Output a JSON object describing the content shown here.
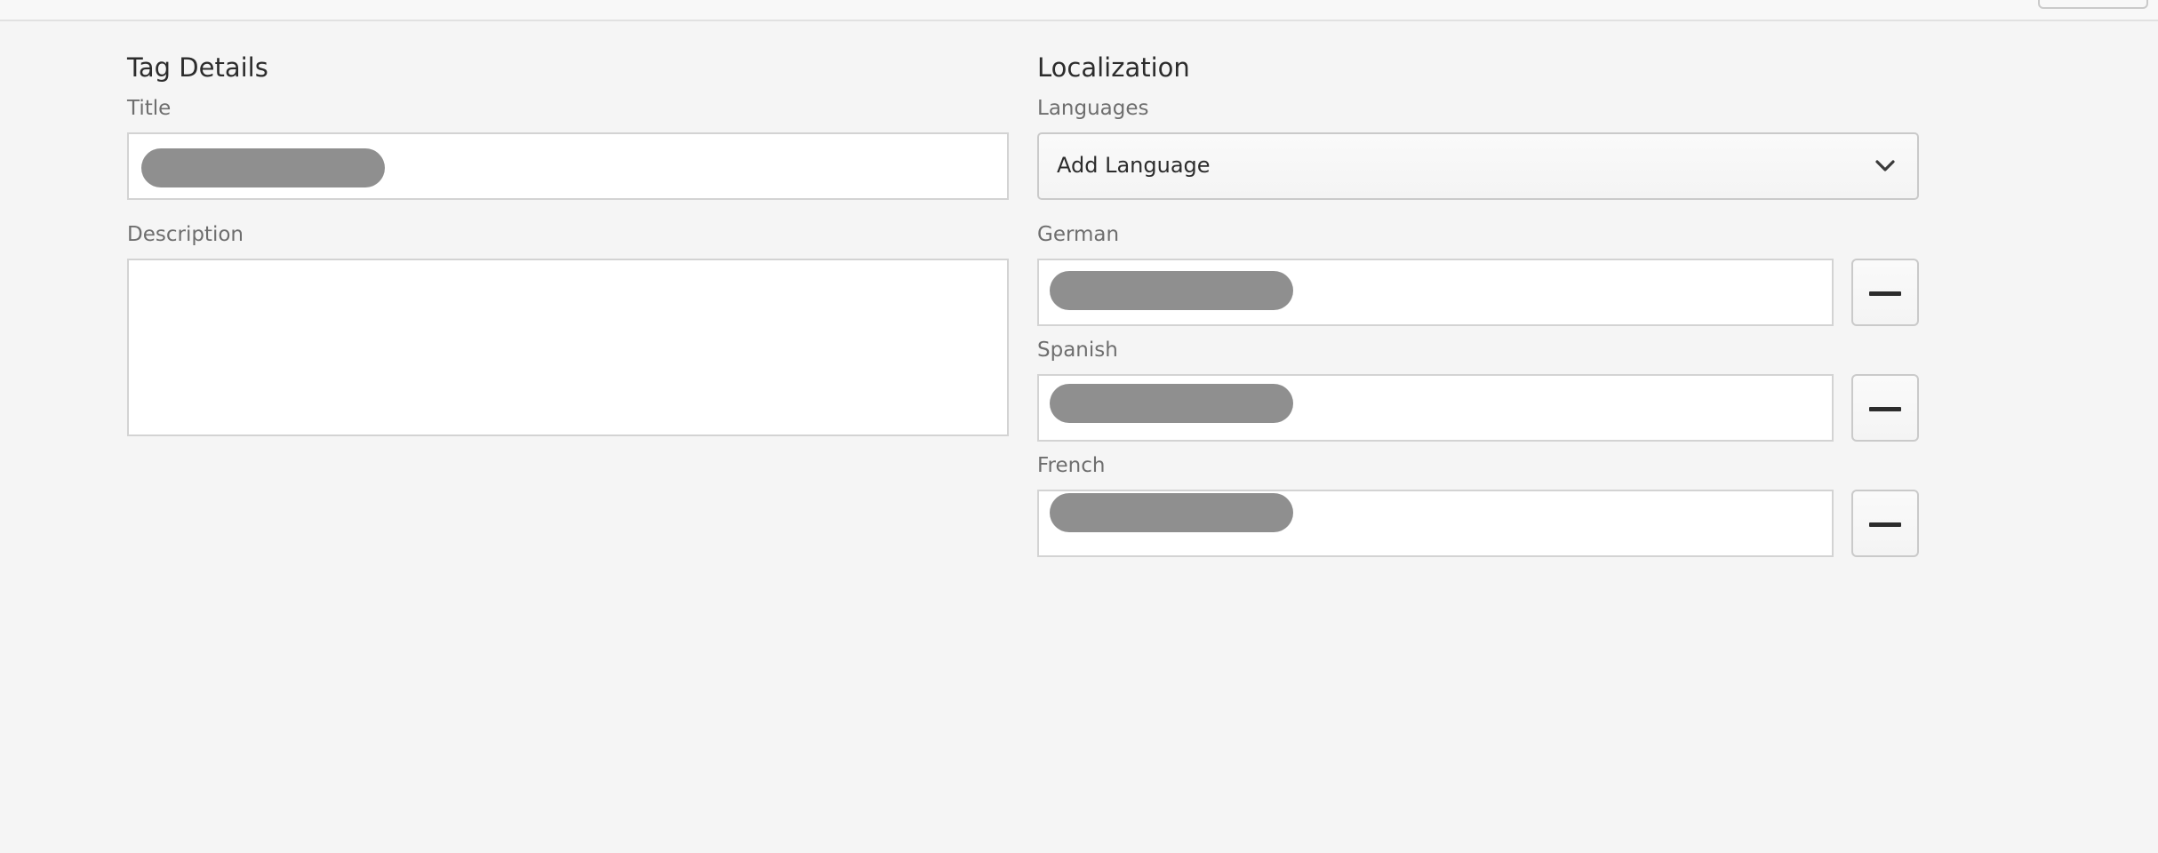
{
  "tag_details": {
    "heading": "Tag Details",
    "title_label": "Title",
    "description_label": "Description"
  },
  "localization": {
    "heading": "Localization",
    "languages_label": "Languages",
    "add_language_select": "Add Language",
    "languages": [
      {
        "label": "German"
      },
      {
        "label": "Spanish"
      },
      {
        "label": "French"
      }
    ]
  },
  "icons": {
    "dropdown": "chevron-down-icon",
    "remove": "minus-icon"
  },
  "colors": {
    "background": "#f5f5f5",
    "redacted_value": "#8f8f8f",
    "label_text": "#6e6e6e"
  }
}
